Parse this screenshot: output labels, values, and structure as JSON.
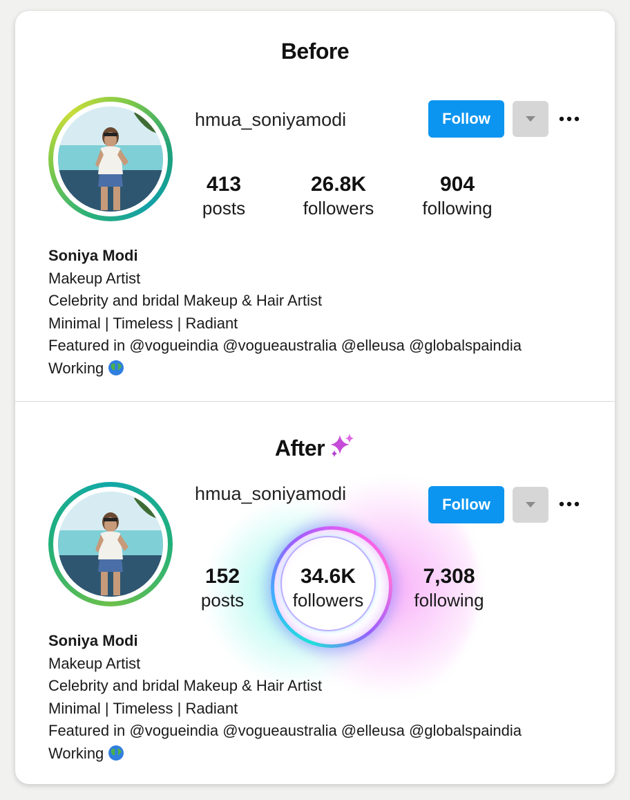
{
  "before": {
    "title": "Before",
    "username": "hmua_soniyamodi",
    "follow_label": "Follow",
    "stats": [
      {
        "value": "413",
        "label": "posts"
      },
      {
        "value": "26.8K",
        "label": "followers"
      },
      {
        "value": "904",
        "label": "following"
      }
    ],
    "bio": {
      "name": "Soniya Modi",
      "lines": [
        "Makeup Artist",
        "Celebrity and bridal Makeup & Hair Artist",
        "Minimal | Timeless | Radiant",
        "Featured in  @vogueindia @vogueaustralia @elleusa @globalspaindia",
        "Working"
      ]
    }
  },
  "after": {
    "title": "After",
    "username": "hmua_soniyamodi",
    "follow_label": "Follow",
    "stats": [
      {
        "value": "152",
        "label": "posts"
      },
      {
        "value": "34.6K",
        "label": "followers"
      },
      {
        "value": "7,308",
        "label": "following"
      }
    ],
    "bio": {
      "name": "Soniya Modi",
      "lines": [
        "Makeup Artist",
        "Celebrity and bridal Makeup & Hair Artist",
        "Minimal | Timeless | Radiant",
        "Featured in  @vogueindia @vogueaustralia @elleusa @globalspaindia",
        "Working"
      ]
    }
  },
  "icons": {
    "globe": "globe-icon",
    "sparkles": "sparkles-icon",
    "more": "more-options-icon",
    "dropdown": "chevron-down-icon"
  },
  "colors": {
    "follow_button": "#0c95f0",
    "dropdown_button": "#d6d6d6",
    "glow_cyan": "#1fe0d8",
    "glow_magenta": "#f05cf0"
  }
}
